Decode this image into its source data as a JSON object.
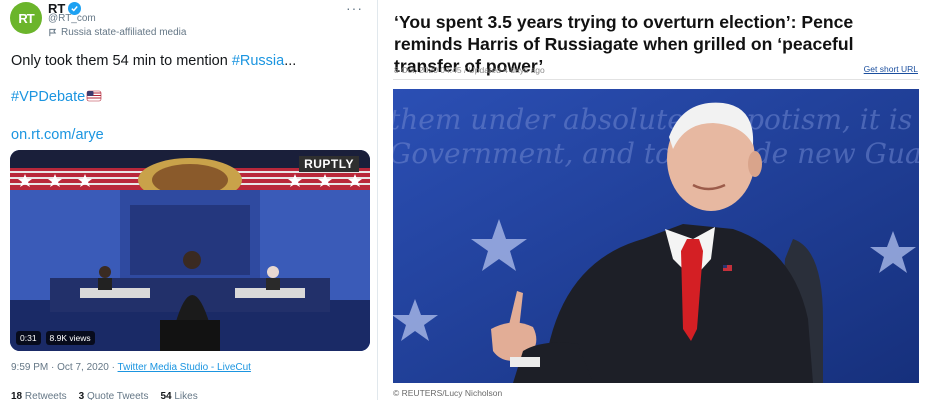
{
  "tweet": {
    "avatar_text": "RT",
    "name": "RT",
    "handle": "@RT_com",
    "affiliation": "Russia state-affiliated media",
    "text_plain": "Only took them 54 min to mention ",
    "text_hashtag": "#Russia",
    "text_ellipsis": "...",
    "hashtag_2": "#VPDebate",
    "link": "on.rt.com/arye",
    "video_duration": "0:31",
    "video_views": "8.9K views",
    "watermark": "RUPTLY",
    "timestamp": "9:59 PM · Oct 7, 2020 · ",
    "source": "Twitter Media Studio - LiveCut",
    "retweets_count": "18",
    "retweets_label": "Retweets",
    "quote_count": "3",
    "quote_label": "Quote Tweets",
    "likes_count": "54",
    "likes_label": "Likes"
  },
  "article": {
    "headline": "‘You spent 3.5 years trying to overturn election’: Pence reminds Harris of Russiagate when grilled on ‘peaceful transfer of power’",
    "dateline": "8 Oct, 2020 04:45 / Updated 4 days ago",
    "short_url_label": "Get short URL",
    "backdrop_line1": "them under absolute Despotism, it is th",
    "backdrop_line2": "Government, and to provide new Guard",
    "caption": "©  REUTERS/Lucy Nicholson"
  },
  "colors": {
    "accent": "#1da1f2",
    "link": "#1b95e0",
    "rt_green": "#6bb52b",
    "stage_blue": "#1e3e9c"
  }
}
